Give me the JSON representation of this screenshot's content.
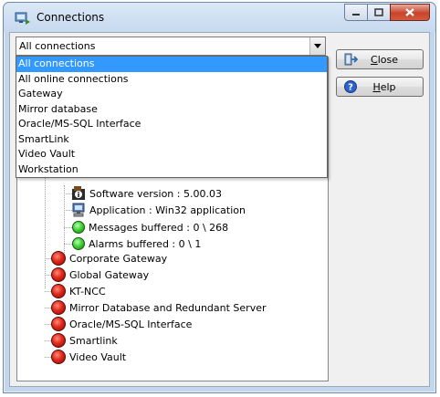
{
  "window": {
    "title": "Connections"
  },
  "filter": {
    "selected": "All connections",
    "options": [
      "All connections",
      "All online connections",
      "Gateway",
      "Mirror database",
      "Oracle/MS-SQL Interface",
      "SmartLink",
      "Video Vault",
      "Workstation"
    ]
  },
  "tree": {
    "details": [
      {
        "icon": "info-icon",
        "label": "Software version : 5.00.03"
      },
      {
        "icon": "computer-icon",
        "label": "Application : Win32 application"
      },
      {
        "icon": "green-status-icon",
        "label": "Messages buffered : 0 \\ 268"
      },
      {
        "icon": "green-status-icon",
        "label": "Alarms buffered : 0 \\ 1"
      }
    ],
    "connections": [
      "Corporate Gateway",
      "Global Gateway",
      "KT-NCC",
      "Mirror Database and Redundant Server",
      "Oracle/MS-SQL Interface",
      "Smartlink",
      "Video Vault"
    ]
  },
  "buttons": {
    "close": "Close",
    "help": "Help"
  },
  "colors": {
    "selection": "#3399ff",
    "offline": "#e0281a",
    "online": "#3ccc30"
  }
}
